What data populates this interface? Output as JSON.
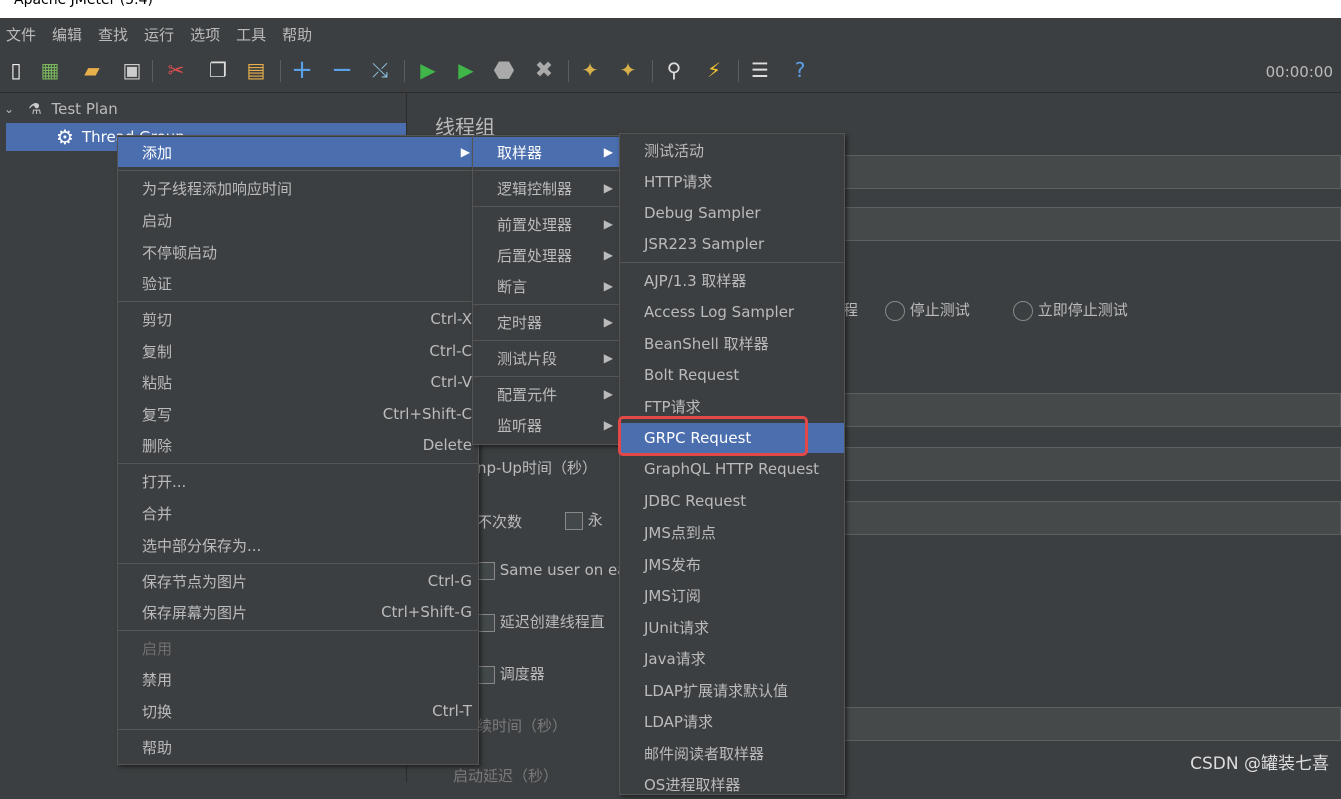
{
  "window": {
    "title": "Apache JMeter (5.4)"
  },
  "menubar": [
    "文件",
    "编辑",
    "查找",
    "运行",
    "选项",
    "工具",
    "帮助"
  ],
  "toolbar": {
    "icons": [
      "new-icon",
      "templates-icon",
      "open-icon",
      "save-icon",
      "cut-icon",
      "copy-icon",
      "paste-icon",
      "expand-icon",
      "collapse-icon",
      "toggle-icon",
      "start-icon",
      "start-no-pause-icon",
      "stop-icon",
      "shutdown-icon",
      "clear-icon",
      "clear-all-icon",
      "search-icon",
      "reset-search-icon",
      "function-helper-icon",
      "help-icon"
    ],
    "timer": "00:00:00"
  },
  "tree": {
    "test_plan": "Test Plan",
    "thread_group": "Thread Group"
  },
  "panel": {
    "title": "线程组",
    "action_fragment": "程",
    "radio_stop_test": "停止测试",
    "radio_stop_now": "立即停止测试",
    "rampup_label": "np-Up时间（秒）",
    "loop_label": "不次数",
    "forever_label": "永",
    "same_user": "Same user on ea",
    "delay_thread": "延迟创建线程直",
    "scheduler": "调度器",
    "duration": "续时间（秒）",
    "startup_delay": "启动延迟（秒）"
  },
  "context_menu": {
    "items": [
      {
        "label": "添加",
        "shortcut": "",
        "submenu": true,
        "selected": true
      },
      {
        "sep": true
      },
      {
        "label": "为子线程添加响应时间",
        "shortcut": ""
      },
      {
        "label": "启动",
        "shortcut": ""
      },
      {
        "label": "不停顿启动",
        "shortcut": ""
      },
      {
        "label": "验证",
        "shortcut": ""
      },
      {
        "sep": true
      },
      {
        "label": "剪切",
        "shortcut": "Ctrl-X"
      },
      {
        "label": "复制",
        "shortcut": "Ctrl-C"
      },
      {
        "label": "粘贴",
        "shortcut": "Ctrl-V"
      },
      {
        "label": "复写",
        "shortcut": "Ctrl+Shift-C"
      },
      {
        "label": "删除",
        "shortcut": "Delete"
      },
      {
        "sep": true
      },
      {
        "label": "打开...",
        "shortcut": ""
      },
      {
        "label": "合并",
        "shortcut": ""
      },
      {
        "label": "选中部分保存为...",
        "shortcut": ""
      },
      {
        "sep": true
      },
      {
        "label": "保存节点为图片",
        "shortcut": "Ctrl-G"
      },
      {
        "label": "保存屏幕为图片",
        "shortcut": "Ctrl+Shift-G"
      },
      {
        "sep": true
      },
      {
        "label": "启用",
        "shortcut": "",
        "disabled": true
      },
      {
        "label": "禁用",
        "shortcut": ""
      },
      {
        "label": "切换",
        "shortcut": "Ctrl-T"
      },
      {
        "sep": true
      },
      {
        "label": "帮助",
        "shortcut": ""
      }
    ]
  },
  "add_submenu": {
    "items": [
      {
        "label": "取样器",
        "selected": true
      },
      {
        "sep": true
      },
      {
        "label": "逻辑控制器"
      },
      {
        "sep": true
      },
      {
        "label": "前置处理器"
      },
      {
        "label": "后置处理器"
      },
      {
        "label": "断言"
      },
      {
        "sep": true
      },
      {
        "label": "定时器"
      },
      {
        "sep": true
      },
      {
        "label": "测试片段"
      },
      {
        "sep": true
      },
      {
        "label": "配置元件"
      },
      {
        "label": "监听器"
      }
    ]
  },
  "sampler_submenu": {
    "items": [
      {
        "label": "测试活动"
      },
      {
        "label": "HTTP请求"
      },
      {
        "label": "Debug Sampler"
      },
      {
        "label": "JSR223 Sampler"
      },
      {
        "sep": true
      },
      {
        "label": "AJP/1.3 取样器"
      },
      {
        "label": "Access Log Sampler"
      },
      {
        "label": "BeanShell 取样器"
      },
      {
        "label": "Bolt Request"
      },
      {
        "label": "FTP请求"
      },
      {
        "label": "GRPC Request",
        "selected": true
      },
      {
        "label": "GraphQL HTTP Request"
      },
      {
        "label": "JDBC Request"
      },
      {
        "label": "JMS点到点"
      },
      {
        "label": "JMS发布"
      },
      {
        "label": "JMS订阅"
      },
      {
        "label": "JUnit请求"
      },
      {
        "label": "Java请求"
      },
      {
        "label": "LDAP扩展请求默认值"
      },
      {
        "label": "LDAP请求"
      },
      {
        "label": "邮件阅读者取样器"
      },
      {
        "label": "OS进程取样器"
      }
    ]
  },
  "watermark": "CSDN @罐装七喜",
  "colors": {
    "selection": "#4b6eaf",
    "highlight_box": "#e24848",
    "background": "#3c3f41"
  }
}
